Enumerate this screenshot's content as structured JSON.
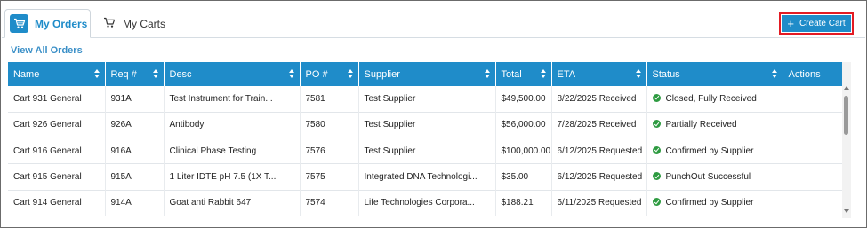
{
  "tabs": {
    "my_orders": "My Orders",
    "my_carts": "My Carts"
  },
  "actions": {
    "create_cart": "Create Cart",
    "view_all_orders": "View All Orders"
  },
  "colors": {
    "accent": "#1f8cc9",
    "highlight_border": "#e31b23",
    "status_ok": "#2e9b41"
  },
  "table": {
    "headers": [
      "Name",
      "Req #",
      "Desc",
      "PO #",
      "Supplier",
      "Total",
      "ETA",
      "Status",
      "Actions"
    ],
    "rows": [
      [
        "Cart 931 General",
        "931A",
        "Test Instrument for Train...",
        "7581",
        "Test Supplier",
        "$49,500.00",
        "8/22/2025 Received",
        "Closed, Fully Received",
        ""
      ],
      [
        "Cart 926 General",
        "926A",
        "Antibody",
        "7580",
        "Test Supplier",
        "$56,000.00",
        "7/28/2025 Received",
        "Partially Received",
        ""
      ],
      [
        "Cart 916 General",
        "916A",
        "Clinical Phase Testing",
        "7576",
        "Test Supplier",
        "$100,000.00",
        "6/12/2025 Requested",
        "Confirmed by Supplier",
        ""
      ],
      [
        "Cart 915 General",
        "915A",
        "1 Liter IDTE pH 7.5 (1X T...",
        "7575",
        "Integrated DNA Technologi...",
        "$35.00",
        "6/12/2025 Requested",
        "PunchOut Successful",
        ""
      ],
      [
        "Cart 914 General",
        "914A",
        "Goat anti Rabbit 647",
        "7574",
        "Life Technologies Corpora...",
        "$188.21",
        "6/11/2025 Requested",
        "Confirmed by Supplier",
        ""
      ]
    ]
  }
}
